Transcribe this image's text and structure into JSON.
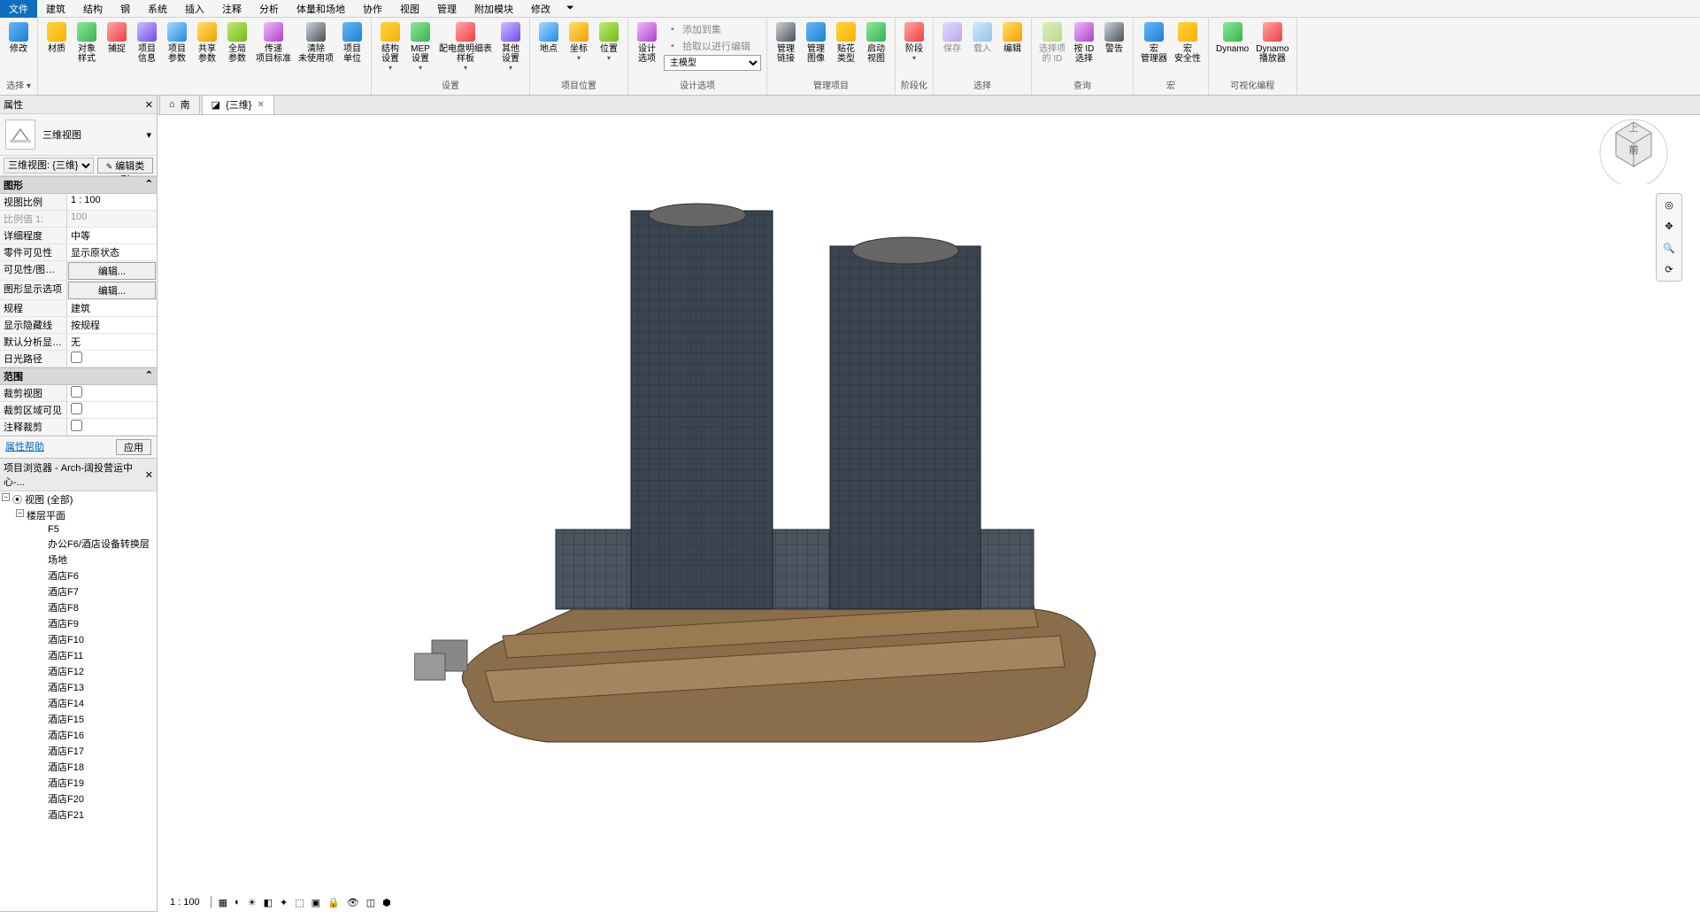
{
  "menu": {
    "items": [
      "文件",
      "建筑",
      "结构",
      "钢",
      "系统",
      "插入",
      "注释",
      "分析",
      "体量和场地",
      "协作",
      "视图",
      "管理",
      "附加模块",
      "修改"
    ],
    "active": "文件"
  },
  "ribbon": {
    "groups": [
      {
        "label": "选择 ▾",
        "items": [
          {
            "label": "修改",
            "icon": "cursor-icon"
          }
        ]
      },
      {
        "label": "",
        "items": [
          {
            "label": "材质",
            "icon": "materials-icon"
          },
          {
            "label": "对象\n样式",
            "icon": "object-styles-icon"
          },
          {
            "label": "捕捉",
            "icon": "snap-icon"
          },
          {
            "label": "项目\n信息",
            "icon": "project-info-icon"
          },
          {
            "label": "项目\n参数",
            "icon": "project-params-icon"
          },
          {
            "label": "共享\n参数",
            "icon": "shared-params-icon"
          },
          {
            "label": "全局\n参数",
            "icon": "global-params-icon"
          },
          {
            "label": "传递\n项目标准",
            "icon": "transfer-icon"
          },
          {
            "label": "清除\n未使用项",
            "icon": "purge-icon"
          },
          {
            "label": "项目\n单位",
            "icon": "units-icon"
          }
        ]
      },
      {
        "label": "设置",
        "items": [
          {
            "label": "结构\n设置",
            "icon": "struct-settings-icon",
            "arrow": true
          },
          {
            "label": "MEP\n设置",
            "icon": "mep-settings-icon",
            "arrow": true
          },
          {
            "label": "配电盘明细表\n样板",
            "icon": "panel-schedule-icon",
            "arrow": true
          },
          {
            "label": "其他\n设置",
            "icon": "other-settings-icon",
            "arrow": true
          }
        ]
      },
      {
        "label": "项目位置",
        "items": [
          {
            "label": "地点",
            "icon": "location-icon"
          },
          {
            "label": "坐标",
            "icon": "coords-icon",
            "arrow": true
          },
          {
            "label": "位置",
            "icon": "position-icon",
            "arrow": true
          }
        ]
      },
      {
        "label": "设计选项",
        "items": [
          {
            "label": "设计\n选项",
            "icon": "design-options-icon"
          }
        ],
        "stack": [
          {
            "label": "添加到集",
            "icon": "add-to-set-icon",
            "disabled": true
          },
          {
            "label": "拾取以进行编辑",
            "icon": "pick-edit-icon",
            "disabled": true
          },
          {
            "type": "select",
            "value": "主模型"
          }
        ]
      },
      {
        "label": "管理项目",
        "items": [
          {
            "label": "管理\n链接",
            "icon": "manage-links-icon"
          },
          {
            "label": "管理\n图像",
            "icon": "manage-images-icon"
          },
          {
            "label": "贴花\n类型",
            "icon": "decal-icon"
          },
          {
            "label": "启动\n视图",
            "icon": "start-view-icon"
          }
        ]
      },
      {
        "label": "阶段化",
        "items": [
          {
            "label": "阶段",
            "icon": "phases-icon",
            "arrow": true
          }
        ]
      },
      {
        "label": "选择",
        "items": [
          {
            "label": "保存",
            "icon": "save-sel-icon",
            "disabled": true
          },
          {
            "label": "载入",
            "icon": "load-sel-icon",
            "disabled": true
          },
          {
            "label": "编辑",
            "icon": "edit-sel-icon"
          }
        ]
      },
      {
        "label": "查询",
        "items": [
          {
            "label": "选择项\n的 ID",
            "icon": "sel-id-icon",
            "disabled": true
          },
          {
            "label": "按 ID\n选择",
            "icon": "by-id-icon"
          },
          {
            "label": "警告",
            "icon": "warnings-icon"
          }
        ]
      },
      {
        "label": "宏",
        "items": [
          {
            "label": "宏\n管理器",
            "icon": "macro-mgr-icon"
          },
          {
            "label": "宏\n安全性",
            "icon": "macro-sec-icon"
          }
        ]
      },
      {
        "label": "可视化编程",
        "items": [
          {
            "label": "Dynamo",
            "icon": "dynamo-icon"
          },
          {
            "label": "Dynamo\n播放器",
            "icon": "dynamo-player-icon"
          }
        ]
      }
    ]
  },
  "tabs": [
    {
      "label": "南",
      "icon": "elevation-icon",
      "active": false
    },
    {
      "label": "{三维}",
      "icon": "view3d-icon",
      "active": true
    }
  ],
  "properties": {
    "title": "属性",
    "type_name": "三维视图",
    "instance_sel": "三维视图: {三维}",
    "edit_type_btn": "编辑类型",
    "sections": [
      {
        "title": "图形",
        "rows": [
          {
            "k": "视图比例",
            "v": "1 : 100"
          },
          {
            "k": "比例值 1:",
            "v": "100",
            "disabled": true
          },
          {
            "k": "详细程度",
            "v": "中等"
          },
          {
            "k": "零件可见性",
            "v": "显示原状态"
          },
          {
            "k": "可见性/图形...",
            "v": "编辑...",
            "btn": true
          },
          {
            "k": "图形显示选项",
            "v": "编辑...",
            "btn": true
          },
          {
            "k": "规程",
            "v": "建筑"
          },
          {
            "k": "显示隐藏线",
            "v": "按规程"
          },
          {
            "k": "默认分析显示...",
            "v": "无"
          },
          {
            "k": "日光路径",
            "v": "",
            "check": false
          }
        ]
      },
      {
        "title": "范围",
        "rows": [
          {
            "k": "裁剪视图",
            "v": "",
            "check": false
          },
          {
            "k": "裁剪区域可见",
            "v": "",
            "check": false
          },
          {
            "k": "注释裁剪",
            "v": "",
            "check": false
          }
        ]
      }
    ],
    "help_link": "属性帮助",
    "apply_btn": "应用"
  },
  "browser": {
    "title": "项目浏览器 - Arch-阔投营运中心-...",
    "root": "视图 (全部)",
    "group": "楼层平面",
    "items": [
      "F5",
      "办公F6/酒店设备转换层",
      "场地",
      "酒店F6",
      "酒店F7",
      "酒店F8",
      "酒店F9",
      "酒店F10",
      "酒店F11",
      "酒店F12",
      "酒店F13",
      "酒店F14",
      "酒店F15",
      "酒店F16",
      "酒店F17",
      "酒店F18",
      "酒店F19",
      "酒店F20",
      "酒店F21"
    ]
  },
  "status": {
    "scale": "1 : 100"
  },
  "viewcube": {
    "face": "前",
    "top": "上"
  }
}
